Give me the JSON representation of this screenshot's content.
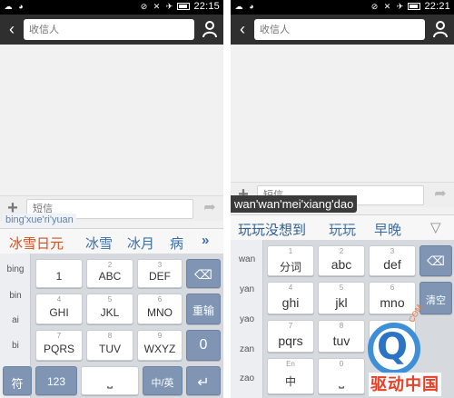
{
  "left": {
    "status": {
      "time": "22:15"
    },
    "header": {
      "back_icon": "chevron-left-icon",
      "recipient_placeholder": "收信人",
      "contact_icon": "person-icon"
    },
    "compose": {
      "add_icon": "plus-icon",
      "placeholder": "短信",
      "send_icon": "send-arrow-icon"
    },
    "composing_text": "bing'xue'ri'yuan",
    "candidates": [
      "冰雪日元",
      "冰雪",
      "冰月",
      "病"
    ],
    "candidate_more": "»",
    "keyboard": {
      "pinyin_options": [
        "bing",
        "bin",
        "ai",
        "bi"
      ],
      "keys": [
        {
          "num": "",
          "label": "1"
        },
        {
          "num": "2",
          "label": "ABC"
        },
        {
          "num": "3",
          "label": "DEF"
        },
        {
          "num": "4",
          "label": "GHI"
        },
        {
          "num": "5",
          "label": "JKL"
        },
        {
          "num": "6",
          "label": "MNO"
        },
        {
          "num": "7",
          "label": "PQRS"
        },
        {
          "num": "8",
          "label": "TUV"
        },
        {
          "num": "9",
          "label": "WXYZ"
        }
      ],
      "backspace_icon": "backspace-icon",
      "reenter_label": "重输",
      "zero_label": "0",
      "symbol_label": "符",
      "num_label": "123",
      "space_icon": "space-icon",
      "lang_label": "中/英",
      "enter_icon": "enter-icon"
    }
  },
  "right": {
    "status": {
      "time": "22:21"
    },
    "header": {
      "back_icon": "chevron-left-icon",
      "recipient_placeholder": "收信人",
      "contact_icon": "person-icon"
    },
    "compose": {
      "add_icon": "plus-icon",
      "placeholder": "短信",
      "send_icon": "send-arrow-icon"
    },
    "composing_text": "wan'wan'mei'xiang'dao",
    "candidates": [
      "玩玩没想到",
      "玩玩",
      "早晚"
    ],
    "candidate_more": "▽",
    "keyboard": {
      "pinyin_options": [
        "wan",
        "yan",
        "yao",
        "zan",
        "zao"
      ],
      "keys": [
        {
          "num": "1",
          "label": "分词"
        },
        {
          "num": "2",
          "label": "abc"
        },
        {
          "num": "3",
          "label": "def"
        },
        {
          "num": "4",
          "label": "ghi"
        },
        {
          "num": "5",
          "label": "jkl"
        },
        {
          "num": "6",
          "label": "mno"
        },
        {
          "num": "7",
          "label": "pqrs"
        },
        {
          "num": "8",
          "label": "tuv"
        },
        {
          "num": "9",
          "label": "wxyz"
        }
      ],
      "backspace_icon": "backspace-icon",
      "clear_label": "清空",
      "bottom_left_num": "En",
      "bottom_left_label": "中",
      "bottom_mid_num": "0"
    }
  },
  "watermark": {
    "logo_letter": "Q",
    "site_text": "驱动中国",
    "site_suffix": "COM"
  },
  "colors": {
    "status_bar": "#000000",
    "title_bar": "#2f2f2f",
    "candidate_highlight": "#d0521f",
    "candidate": "#3d6ea0",
    "function_key": "#7f95b3",
    "keyboard_bg": "#d6d9de"
  }
}
